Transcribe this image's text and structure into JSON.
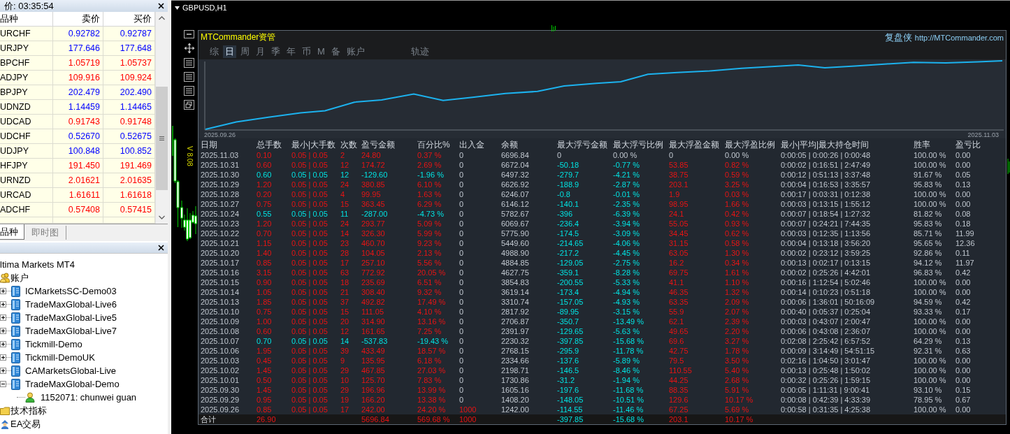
{
  "market_watch": {
    "title": "价: 03:35:54",
    "columns": [
      "品种",
      "卖价",
      "买价"
    ],
    "rows": [
      {
        "symbol": "URCHF",
        "bid": "0.92782",
        "ask": "0.92787",
        "color": "#0000ff"
      },
      {
        "symbol": "URJPY",
        "bid": "177.646",
        "ask": "177.648",
        "color": "#0000ff"
      },
      {
        "symbol": "BPCHF",
        "bid": "1.05719",
        "ask": "1.05737",
        "color": "#ff0000"
      },
      {
        "symbol": "ADJPY",
        "bid": "109.916",
        "ask": "109.924",
        "color": "#ff0000"
      },
      {
        "symbol": "BPJPY",
        "bid": "202.479",
        "ask": "202.490",
        "color": "#0000ff"
      },
      {
        "symbol": "UDNZD",
        "bid": "1.14459",
        "ask": "1.14465",
        "color": "#0000ff"
      },
      {
        "symbol": "UDCAD",
        "bid": "0.91743",
        "ask": "0.91748",
        "color": "#ff0000"
      },
      {
        "symbol": "UDCHF",
        "bid": "0.52670",
        "ask": "0.52675",
        "color": "#0000ff"
      },
      {
        "symbol": "UDJPY",
        "bid": "100.848",
        "ask": "100.852",
        "color": "#0000ff"
      },
      {
        "symbol": "HFJPY",
        "bid": "191.450",
        "ask": "191.469",
        "color": "#ff0000"
      },
      {
        "symbol": "URNZD",
        "bid": "2.01621",
        "ask": "2.01635",
        "color": "#ff0000"
      },
      {
        "symbol": "URCAD",
        "bid": "1.61611",
        "ask": "1.61618",
        "color": "#ff0000"
      },
      {
        "symbol": "ADCHF",
        "bid": "0.57408",
        "ask": "0.57415",
        "color": "#ff0000"
      }
    ],
    "tabs": [
      {
        "label": "品种",
        "selected": true
      },
      {
        "label": "即时图",
        "selected": false
      }
    ]
  },
  "navigator": {
    "root": "ltima Markets MT4",
    "items": [
      {
        "label": "账户",
        "kind": "accounts",
        "children": [
          {
            "label": "ICMarketsSC-Demo03",
            "kind": "server",
            "expanded": false
          },
          {
            "label": "TradeMaxGlobal-Live6",
            "kind": "server",
            "expanded": false
          },
          {
            "label": "TradeMaxGlobal-Live5",
            "kind": "server",
            "expanded": false
          },
          {
            "label": "TradeMaxGlobal-Live7",
            "kind": "server",
            "expanded": false
          },
          {
            "label": "Tickmill-Demo",
            "kind": "server",
            "expanded": false
          },
          {
            "label": "Tickmill-DemoUK",
            "kind": "server",
            "expanded": false
          },
          {
            "label": "CAMarketsGlobal-Live",
            "kind": "server",
            "expanded": false
          },
          {
            "label": "TradeMaxGlobal-Demo",
            "kind": "server",
            "expanded": true,
            "children": [
              {
                "label": "1152071: chunwei guan",
                "kind": "account"
              }
            ]
          }
        ]
      },
      {
        "label": "技术指标",
        "kind": "indicators"
      },
      {
        "label": "EA交易",
        "kind": "experts"
      }
    ]
  },
  "chart": {
    "title": "GBPUSD,H1",
    "version": "V 8.08"
  },
  "commander": {
    "title": "MTCommander资管",
    "brand": "复盘侠",
    "link": "http://MTCommander.com",
    "tabs": [
      {
        "label": "综",
        "selected": false
      },
      {
        "label": "日",
        "selected": true
      },
      {
        "label": "周",
        "selected": false
      },
      {
        "label": "月",
        "selected": false
      },
      {
        "label": "季",
        "selected": false
      },
      {
        "label": "年",
        "selected": false
      },
      {
        "label": "币",
        "selected": false
      },
      {
        "label": "M",
        "selected": false
      },
      {
        "label": "备",
        "selected": false
      },
      {
        "label": "账户",
        "selected": false
      }
    ],
    "side_tabs": [
      {
        "label": "轨迹",
        "selected": false
      }
    ],
    "balance_chart": {
      "start_label": "2025.09.26",
      "end_label": "2025.11.03"
    },
    "table": {
      "columns": [
        {
          "label": "日期",
          "kind": "plain"
        },
        {
          "label": "总手数",
          "kind": "signed"
        },
        {
          "label": "最小|大手数",
          "kind": "signed"
        },
        {
          "label": "次数",
          "kind": "signed"
        },
        {
          "label": "盈亏金额",
          "kind": "signed"
        },
        {
          "label": "百分比%",
          "kind": "signed"
        },
        {
          "label": "出入金",
          "kind": "deposit"
        },
        {
          "label": "余额",
          "kind": "plain"
        },
        {
          "label": "最大浮亏金额",
          "kind": "loss"
        },
        {
          "label": "最大浮亏比例",
          "kind": "loss"
        },
        {
          "label": "最大浮盈金额",
          "kind": "gain"
        },
        {
          "label": "最大浮盈比例",
          "kind": "gain"
        },
        {
          "label": "最小|平均|最大持仓时间",
          "kind": "plain"
        },
        {
          "label": "胜率",
          "kind": "plain"
        },
        {
          "label": "盈亏比",
          "kind": "plain"
        }
      ],
      "rows": [
        {
          "cells": [
            "2025.11.03",
            "0.10",
            "0.05 | 0.05",
            "2",
            "24.80",
            "0.37 %",
            "0",
            "6696.84",
            "0",
            "0.00 %",
            "0",
            "0.00 %",
            "0:00:05 | 0:00:26 | 0:00:48",
            "100.00 %",
            "0.00"
          ],
          "loss": false,
          "float_zero": true,
          "deposit": false
        },
        {
          "cells": [
            "2025.10.31",
            "0.60",
            "0.05 | 0.05",
            "12",
            "174.72",
            "2.69 %",
            "0",
            "6672.04",
            "-50.18",
            "-0.77 %",
            "53.85",
            "0.82 %",
            "0:00:02 | 0:16:51 | 2:47:49",
            "100.00 %",
            "0.00"
          ],
          "loss": false,
          "float_zero": false,
          "deposit": false
        },
        {
          "cells": [
            "2025.10.30",
            "0.60",
            "0.05 | 0.05",
            "12",
            "-129.60",
            "-1.96 %",
            "0",
            "6497.32",
            "-279.7",
            "-4.21 %",
            "38.75",
            "0.59 %",
            "0:00:12 | 0:51:13 | 3:37:48",
            "91.67 %",
            "0.05"
          ],
          "loss": true,
          "float_zero": false,
          "deposit": false
        },
        {
          "cells": [
            "2025.10.29",
            "1.20",
            "0.05 | 0.05",
            "24",
            "380.85",
            "6.10 %",
            "0",
            "6626.92",
            "-188.9",
            "-2.87 %",
            "203.1",
            "3.25 %",
            "0:00:04 | 0:16:53 | 3:35:57",
            "95.83 %",
            "0.13"
          ],
          "loss": false,
          "float_zero": false,
          "deposit": false
        },
        {
          "cells": [
            "2025.10.28",
            "0.20",
            "0.05 | 0.05",
            "4",
            "99.95",
            "1.63 %",
            "0",
            "6246.07",
            "-0.8",
            "-0.01 %",
            "1.9",
            "0.03 %",
            "0:00:17 | 0:03:31 | 0:12:38",
            "100.00 %",
            "0.00"
          ],
          "loss": false,
          "float_zero": false,
          "deposit": false
        },
        {
          "cells": [
            "2025.10.27",
            "0.75",
            "0.05 | 0.05",
            "15",
            "363.45",
            "6.29 %",
            "0",
            "6146.12",
            "-140.1",
            "-2.35 %",
            "98.95",
            "1.66 %",
            "0:00:03 | 0:13:15 | 1:55:12",
            "100.00 %",
            "0.00"
          ],
          "loss": false,
          "float_zero": false,
          "deposit": false
        },
        {
          "cells": [
            "2025.10.24",
            "0.55",
            "0.05 | 0.05",
            "11",
            "-287.00",
            "-4.73 %",
            "0",
            "5782.67",
            "-396",
            "-6.39 %",
            "24.1",
            "0.42 %",
            "0:00:07 | 0:18:54 | 1:27:32",
            "81.82 %",
            "0.08"
          ],
          "loss": true,
          "float_zero": false,
          "deposit": false
        },
        {
          "cells": [
            "2025.10.23",
            "1.20",
            "0.05 | 0.05",
            "24",
            "293.77",
            "5.09 %",
            "0",
            "6069.67",
            "-236.4",
            "-3.94 %",
            "55.05",
            "0.93 %",
            "0:00:07 | 0:24:21 | 7:44:35",
            "95.83 %",
            "0.18"
          ],
          "loss": false,
          "float_zero": false,
          "deposit": false
        },
        {
          "cells": [
            "2025.10.22",
            "0.70",
            "0.05 | 0.05",
            "14",
            "326.30",
            "5.99 %",
            "0",
            "5775.90",
            "-174.5",
            "-3.09 %",
            "34.45",
            "0.62 %",
            "0:00:03 | 0:12:35 | 1:13:56",
            "85.71 %",
            "11.99"
          ],
          "loss": false,
          "float_zero": false,
          "deposit": false
        },
        {
          "cells": [
            "2025.10.21",
            "1.15",
            "0.05 | 0.05",
            "23",
            "460.70",
            "9.23 %",
            "0",
            "5449.60",
            "-214.65",
            "-4.06 %",
            "31.15",
            "0.58 %",
            "0:00:04 | 0:13:18 | 3:56:20",
            "95.65 %",
            "12.36"
          ],
          "loss": false,
          "float_zero": false,
          "deposit": false
        },
        {
          "cells": [
            "2025.10.20",
            "1.40",
            "0.05 | 0.05",
            "28",
            "104.05",
            "2.13 %",
            "0",
            "4988.90",
            "-217.2",
            "-4.45 %",
            "63.05",
            "1.30 %",
            "0:00:02 | 0:23:12 | 3:59:25",
            "92.86 %",
            "0.11"
          ],
          "loss": false,
          "float_zero": false,
          "deposit": false
        },
        {
          "cells": [
            "2025.10.17",
            "0.85",
            "0.05 | 0.05",
            "17",
            "257.10",
            "5.56 %",
            "0",
            "4884.85",
            "-129.05",
            "-2.75 %",
            "16.2",
            "0.34 %",
            "0:00:13 | 0:02:17 | 0:13:15",
            "94.12 %",
            "11.97"
          ],
          "loss": false,
          "float_zero": false,
          "deposit": false
        },
        {
          "cells": [
            "2025.10.16",
            "3.15",
            "0.05 | 0.05",
            "63",
            "772.92",
            "20.05 %",
            "0",
            "4627.75",
            "-359.1",
            "-8.28 %",
            "69.75",
            "1.61 %",
            "0:00:02 | 0:25:26 | 4:42:01",
            "96.83 %",
            "0.42"
          ],
          "loss": false,
          "float_zero": false,
          "deposit": false
        },
        {
          "cells": [
            "2025.10.15",
            "0.90",
            "0.05 | 0.05",
            "18",
            "235.69",
            "6.51 %",
            "0",
            "3854.83",
            "-200.55",
            "-5.33 %",
            "41.1",
            "1.10 %",
            "0:00:16 | 1:12:54 | 5:02:46",
            "100.00 %",
            "0.00"
          ],
          "loss": false,
          "float_zero": false,
          "deposit": false
        },
        {
          "cells": [
            "2025.10.14",
            "1.05",
            "0.05 | 0.05",
            "21",
            "308.40",
            "9.32 %",
            "0",
            "3619.14",
            "-173.4",
            "-4.94 %",
            "46.35",
            "1.32 %",
            "0:00:14 | 0:10:23 | 0:51:18",
            "100.00 %",
            "0.00"
          ],
          "loss": false,
          "float_zero": false,
          "deposit": false
        },
        {
          "cells": [
            "2025.10.13",
            "1.85",
            "0.05 | 0.05",
            "37",
            "492.82",
            "17.49 %",
            "0",
            "3310.74",
            "-157.05",
            "-4.93 %",
            "63.35",
            "2.09 %",
            "0:00:06 | 1:36:01 | 50:16:09",
            "94.59 %",
            "0.42"
          ],
          "loss": false,
          "float_zero": false,
          "deposit": false
        },
        {
          "cells": [
            "2025.10.10",
            "0.75",
            "0.05 | 0.05",
            "15",
            "111.05",
            "4.10 %",
            "0",
            "2817.92",
            "-89.95",
            "-3.15 %",
            "55.9",
            "2.07 %",
            "0:00:40 | 0:05:37 | 0:25:04",
            "93.33 %",
            "0.17"
          ],
          "loss": false,
          "float_zero": false,
          "deposit": false
        },
        {
          "cells": [
            "2025.10.09",
            "1.00",
            "0.05 | 0.05",
            "20",
            "314.90",
            "13.16 %",
            "0",
            "2706.87",
            "-350.7",
            "-13.49 %",
            "62.1",
            "2.39 %",
            "0:00:03 | 0:43:07 | 2:00:47",
            "100.00 %",
            "0.00"
          ],
          "loss": false,
          "float_zero": false,
          "deposit": false
        },
        {
          "cells": [
            "2025.10.08",
            "0.60",
            "0.05 | 0.05",
            "12",
            "161.65",
            "7.25 %",
            "0",
            "2391.97",
            "-129.65",
            "-5.63 %",
            "49.65",
            "2.20 %",
            "0:00:06 | 0:43:08 | 2:36:07",
            "100.00 %",
            "0.00"
          ],
          "loss": false,
          "float_zero": false,
          "deposit": false
        },
        {
          "cells": [
            "2025.10.07",
            "0.70",
            "0.05 | 0.05",
            "14",
            "-537.83",
            "-19.43 %",
            "0",
            "2230.32",
            "-397.85",
            "-15.68 %",
            "69.6",
            "3.27 %",
            "0:02:08 | 2:25:42 | 6:57:52",
            "64.29 %",
            "0.13"
          ],
          "loss": true,
          "float_zero": false,
          "deposit": false
        },
        {
          "cells": [
            "2025.10.06",
            "1.95",
            "0.05 | 0.05",
            "39",
            "433.49",
            "18.57 %",
            "0",
            "2768.15",
            "-295.9",
            "-11.78 %",
            "42.75",
            "1.78 %",
            "0:00:09 | 3:14:49 | 54:51:15",
            "92.31 %",
            "0.63"
          ],
          "loss": false,
          "float_zero": false,
          "deposit": false
        },
        {
          "cells": [
            "2025.10.03",
            "0.45",
            "0.05 | 0.05",
            "9",
            "135.95",
            "6.18 %",
            "0",
            "2334.66",
            "-137.6",
            "-5.89 %",
            "79.5",
            "3.50 %",
            "0:02:16 | 1:04:50 | 3:01:47",
            "100.00 %",
            "0.00"
          ],
          "loss": false,
          "float_zero": false,
          "deposit": false
        },
        {
          "cells": [
            "2025.10.02",
            "1.45",
            "0.05 | 0.05",
            "29",
            "467.85",
            "27.03 %",
            "0",
            "2198.71",
            "-146.5",
            "-8.46 %",
            "110.55",
            "5.40 %",
            "0:00:13 | 0:25:48 | 1:50:02",
            "100.00 %",
            "0.00"
          ],
          "loss": false,
          "float_zero": false,
          "deposit": false
        },
        {
          "cells": [
            "2025.10.01",
            "0.50",
            "0.05 | 0.05",
            "10",
            "125.70",
            "7.83 %",
            "0",
            "1730.86",
            "-31.2",
            "-1.94 %",
            "44.25",
            "2.68 %",
            "0:00:32 | 0:25:26 | 1:59:15",
            "100.00 %",
            "0.00"
          ],
          "loss": false,
          "float_zero": false,
          "deposit": false
        },
        {
          "cells": [
            "2025.09.30",
            "1.45",
            "0.05 | 0.05",
            "29",
            "196.96",
            "13.99 %",
            "0",
            "1605.16",
            "-197.6",
            "-11.68 %",
            "88.35",
            "5.91 %",
            "0:00:05 | 1:11:31 | 9:00:41",
            "93.10 %",
            "0.15"
          ],
          "loss": false,
          "float_zero": false,
          "deposit": false
        },
        {
          "cells": [
            "2025.09.29",
            "0.95",
            "0.05 | 0.05",
            "19",
            "166.20",
            "13.38 %",
            "0",
            "1408.20",
            "-148.05",
            "-10.51 %",
            "129.6",
            "10.17 %",
            "0:00:08 | 0:42:39 | 4:33:39",
            "78.95 %",
            "0.67"
          ],
          "loss": false,
          "float_zero": false,
          "deposit": false
        },
        {
          "cells": [
            "2025.09.26",
            "0.85",
            "0.05 | 0.05",
            "17",
            "242.00",
            "24.20 %",
            "1000",
            "1242.00",
            "-114.55",
            "-11.46 %",
            "67.25",
            "5.69 %",
            "0:00:58 | 0:31:35 | 4:25:38",
            "100.00 %",
            "0.00"
          ],
          "loss": false,
          "float_zero": false,
          "deposit": true
        }
      ],
      "total": {
        "cells": [
          "合计",
          "26.90",
          null,
          null,
          "5696.84",
          "569.68 %",
          "1000",
          null,
          "-397.85",
          "-15.68 %",
          "203.1",
          "10.17 %",
          null,
          null,
          null
        ],
        "loss": false,
        "float_zero": false,
        "deposit": true
      }
    }
  }
}
